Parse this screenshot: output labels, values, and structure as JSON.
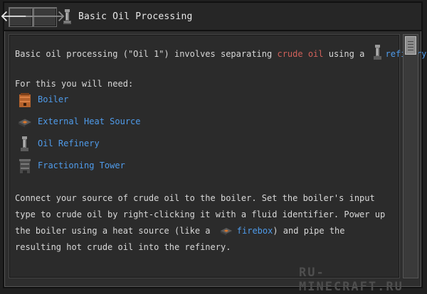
{
  "window": {
    "title": "Basic Oil Processing"
  },
  "nav": {
    "back_glyph": "🡐",
    "forward_glyph": "🡒"
  },
  "intro": {
    "part1": "Basic oil processing (\"Oil 1\") involves separating ",
    "crude_oil": "crude oil",
    "part2": " using a ",
    "refinery": "refinery",
    "part3": "."
  },
  "requirements": {
    "heading": "For this you will need:",
    "items": [
      {
        "label": "Boiler",
        "icon": "boiler-icon"
      },
      {
        "label": "External Heat Source",
        "icon": "heat-source-icon"
      },
      {
        "label": "Oil Refinery",
        "icon": "oil-refinery-icon"
      },
      {
        "label": "Fractioning Tower",
        "icon": "fractioning-tower-icon"
      }
    ]
  },
  "instructions": {
    "part1": "Connect your source of crude oil to the boiler. Set the boiler's input type to crude oil by right-clicking it with a fluid identifier. Power up the boiler using a heat source (like a ",
    "firebox": "firebox",
    "part2": ") and pipe the resulting hot crude oil into the refinery."
  },
  "watermark": "RU-MINECRAFT.RU",
  "colors": {
    "link": "#4f9bea",
    "highlight": "#d0605a",
    "text": "#d8d8d8"
  }
}
